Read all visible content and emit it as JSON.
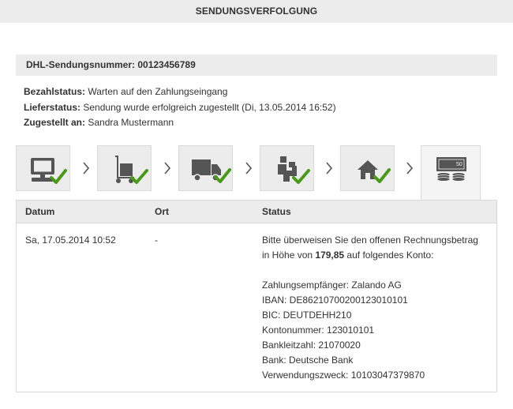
{
  "header": {
    "title": "SENDUNGSVERFOLGUNG"
  },
  "tracking": {
    "label": "DHL-Sendungsnummer:",
    "number": "00123456789"
  },
  "info": {
    "payment_label": "Bezahlstatus:",
    "payment_value": "Warten auf den Zahlungseingang",
    "delivery_label": "Lieferstatus:",
    "delivery_value": "Sendung wurde erfolgreich zugestellt (Di, 13.05.2014 16:52)",
    "recipient_label": "Zugestellt an:",
    "recipient_value": "Sandra Mustermann"
  },
  "steps": [
    {
      "icon": "computer-icon",
      "completed": true
    },
    {
      "icon": "warehouse-cart-icon",
      "completed": true
    },
    {
      "icon": "delivery-truck-icon",
      "completed": true
    },
    {
      "icon": "handover-icon",
      "completed": true
    },
    {
      "icon": "house-icon",
      "completed": true
    },
    {
      "icon": "payment-money-icon",
      "completed": false,
      "active": true,
      "badge": "50"
    }
  ],
  "colors": {
    "check": "#4a9a1a",
    "icon": "#555555",
    "header_bg": "#ececec",
    "border": "#d9d9d9"
  },
  "table": {
    "headers": {
      "date": "Datum",
      "place": "Ort",
      "status": "Status"
    },
    "rows": [
      {
        "date": "Sa, 17.05.2014 10:52",
        "place": "-",
        "status_line1": "Bitte überweisen Sie den offenen Rechnungsbetrag",
        "status_line2_pre": "in Höhe von ",
        "status_amount": "179,85",
        "status_line2_post": " auf folgendes Konto:",
        "details": [
          "Zahlungsempfänger: Zalando AG",
          "IBAN: DE86210700200123010101",
          "BIC: DEUTDEHH210",
          "Kontonummer: 123010101",
          "Bankleitzahl: 21070020",
          "Bank: Deutsche Bank",
          "Verwendungszweck: 10103047379870"
        ]
      }
    ]
  }
}
